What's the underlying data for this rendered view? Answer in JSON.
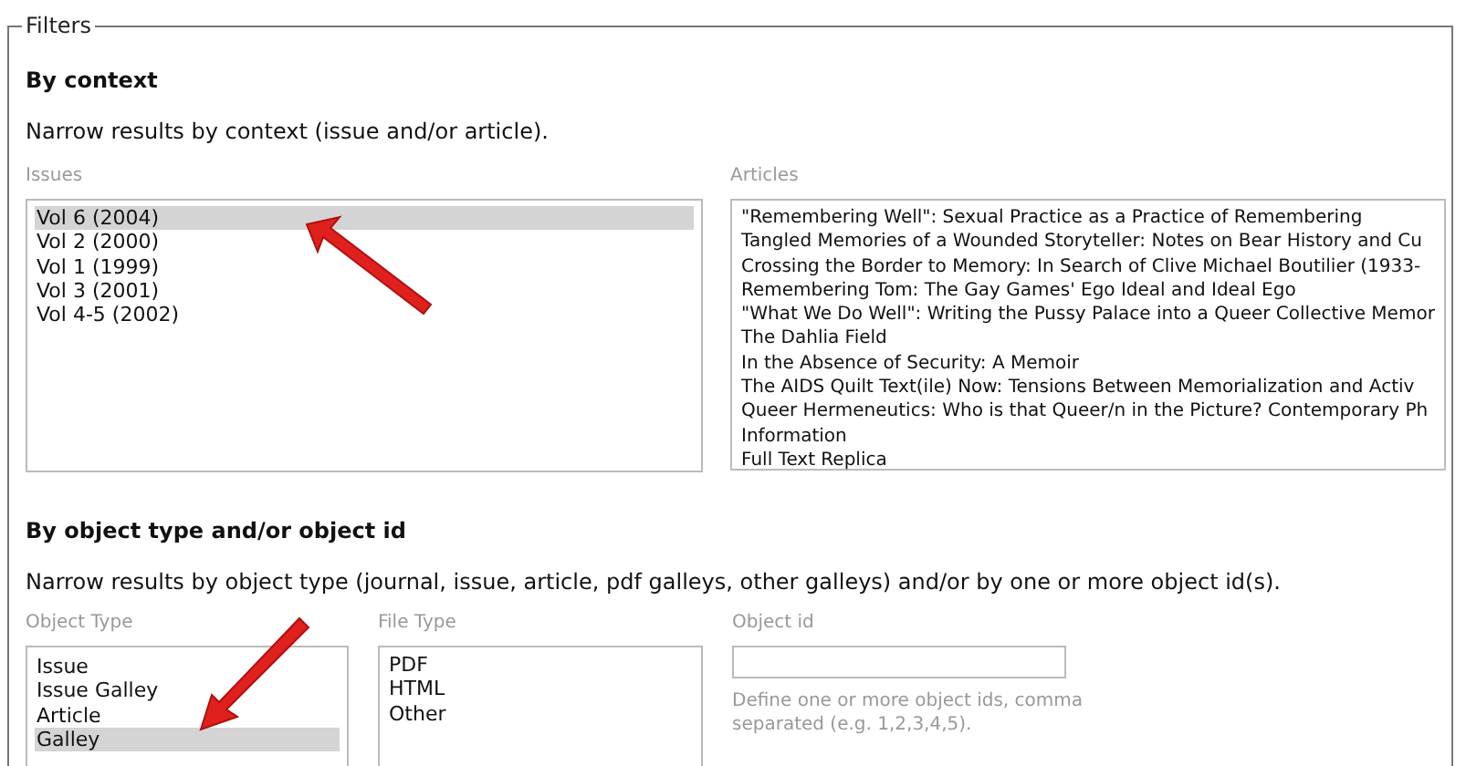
{
  "fieldset": {
    "legend": "Filters"
  },
  "context": {
    "heading": "By context",
    "description": "Narrow results by context (issue and/or article).",
    "issues": {
      "label": "Issues",
      "items": [
        {
          "text": "Vol 6 (2004)",
          "selected": true
        },
        {
          "text": "Vol 2 (2000)",
          "selected": false
        },
        {
          "text": "Vol 1 (1999)",
          "selected": false
        },
        {
          "text": "Vol 3 (2001)",
          "selected": false
        },
        {
          "text": "Vol 4-5 (2002)",
          "selected": false
        }
      ]
    },
    "articles": {
      "label": "Articles",
      "items": [
        {
          "text": "\"Remembering Well\": Sexual Practice as a Practice of Remembering",
          "selected": false
        },
        {
          "text": "Tangled Memories of a Wounded Storyteller: Notes on Bear History and Cu",
          "selected": false
        },
        {
          "text": "Crossing the Border to Memory: In Search of Clive Michael Boutilier (1933-",
          "selected": false
        },
        {
          "text": "Remembering Tom: The Gay Games' Ego Ideal and Ideal Ego",
          "selected": false
        },
        {
          "text": "\"What We Do Well\": Writing the Pussy Palace into a Queer Collective Memor",
          "selected": false
        },
        {
          "text": "The Dahlia Field",
          "selected": false
        },
        {
          "text": "In the Absence of Security: A Memoir",
          "selected": false
        },
        {
          "text": "The AIDS Quilt Text(ile) Now: Tensions Between Memorialization and Activ",
          "selected": false
        },
        {
          "text": "Queer Hermeneutics: Who is that Queer/n in the Picture? Contemporary Ph",
          "selected": false
        },
        {
          "text": "Information",
          "selected": false
        },
        {
          "text": "Full Text Replica",
          "selected": false
        }
      ]
    }
  },
  "object": {
    "heading": "By object type and/or object id",
    "description": "Narrow results by object type (journal, issue, article, pdf galleys, other galleys) and/or by one or more object id(s).",
    "object_type": {
      "label": "Object Type",
      "items": [
        {
          "text": "Issue",
          "selected": false
        },
        {
          "text": "Issue Galley",
          "selected": false
        },
        {
          "text": "Article",
          "selected": false
        },
        {
          "text": "Galley",
          "selected": true
        }
      ]
    },
    "file_type": {
      "label": "File Type",
      "items": [
        {
          "text": "PDF",
          "selected": false
        },
        {
          "text": "HTML",
          "selected": false
        },
        {
          "text": "Other",
          "selected": false
        }
      ]
    },
    "object_id": {
      "label": "Object id",
      "help": "Define one or more object ids, comma separated (e.g. 1,2,3,4,5)."
    }
  }
}
